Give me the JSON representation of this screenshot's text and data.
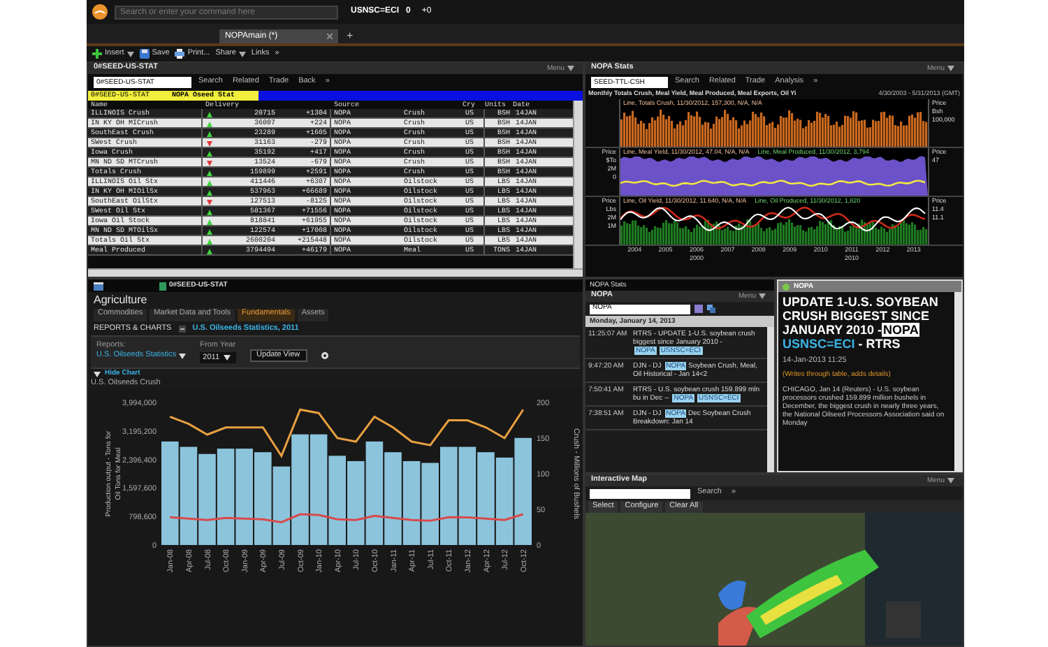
{
  "top_bar": {
    "placeholder": "Search or enter your command here",
    "ticker": "USNSC=ECI",
    "ticker_value": "0",
    "ticker_change": "+0"
  },
  "workspace_tabs": [
    {
      "label": "NOPAmain (*)",
      "selected": true
    }
  ],
  "add_tab": "+",
  "toolbar": [
    {
      "label": "Insert",
      "kind": "add"
    },
    {
      "label": "Save",
      "kind": "save"
    },
    {
      "label": "Print...",
      "kind": "print"
    },
    {
      "label": "Share",
      "kind": "menu"
    },
    {
      "label": "Links",
      "kind": "plain"
    },
    {
      "label": "»",
      "kind": "plain"
    }
  ],
  "quote_list": {
    "title": "0#SEED-US-STAT",
    "menu": "Menu",
    "code": "0#SEED-US-STAT",
    "tools": [
      "Search",
      "Related",
      "Trade",
      "Back",
      "»"
    ],
    "chain": "0#SEED-US-STAT",
    "chain_title": "NOPA Oseed Stat",
    "columns": [
      "Name",
      "Delivery",
      "Source",
      "Cry",
      "Units",
      "Date"
    ],
    "rows": [
      {
        "name": "ILLINOIS Crush",
        "up": true,
        "value": "20715",
        "change": "+1304",
        "source": "NOPA",
        "type": "Crush",
        "country": "US",
        "units": "BSH",
        "date": "14JAN"
      },
      {
        "name": "IN KY OH MICrush",
        "up": true,
        "value": "36007",
        "change": "+224",
        "source": "NOPA",
        "type": "Crush",
        "country": "US",
        "units": "BSH",
        "date": "14JAN"
      },
      {
        "name": "SouthEast Crush",
        "up": true,
        "value": "23289",
        "change": "+1605",
        "source": "NOPA",
        "type": "Crush",
        "country": "US",
        "units": "BSH",
        "date": "14JAN"
      },
      {
        "name": "SWest Crush",
        "up": false,
        "value": "31163",
        "change": "-279",
        "source": "NOPA",
        "type": "Crush",
        "country": "US",
        "units": "BSH",
        "date": "14JAN"
      },
      {
        "name": "Iowa Crush",
        "up": true,
        "value": "35192",
        "change": "+417",
        "source": "NOPA",
        "type": "Crush",
        "country": "US",
        "units": "BSH",
        "date": "14JAN"
      },
      {
        "name": "MN ND SD MTCrush",
        "up": false,
        "value": "13524",
        "change": "-679",
        "source": "NOPA",
        "type": "Crush",
        "country": "US",
        "units": "BSH",
        "date": "14JAN"
      },
      {
        "name": "Totals Crush",
        "up": true,
        "value": "159899",
        "change": "+2591",
        "source": "NOPA",
        "type": "Crush",
        "country": "US",
        "units": "BSH",
        "date": "14JAN"
      },
      {
        "name": "ILLINOIS Oil Stx",
        "up": true,
        "value": "411446",
        "change": "+6307",
        "source": "NOPA",
        "type": "Oilstock",
        "country": "US",
        "units": "LBS",
        "date": "14JAN"
      },
      {
        "name": "IN KY OH MIOilSx",
        "up": true,
        "value": "537963",
        "change": "+66689",
        "source": "NOPA",
        "type": "Oilstock",
        "country": "US",
        "units": "LBS",
        "date": "14JAN"
      },
      {
        "name": "SouthEast OilStx",
        "up": false,
        "value": "127513",
        "change": "-8125",
        "source": "NOPA",
        "type": "Oilstock",
        "country": "US",
        "units": "LBS",
        "date": "14JAN"
      },
      {
        "name": "SWest Oil Stx",
        "up": true,
        "value": "581367",
        "change": "+71556",
        "source": "NOPA",
        "type": "Oilstock",
        "country": "US",
        "units": "LBS",
        "date": "14JAN"
      },
      {
        "name": "Iowa Oil Stock",
        "up": true,
        "value": "818841",
        "change": "+61955",
        "source": "NOPA",
        "type": "Oilstock",
        "country": "US",
        "units": "LBS",
        "date": "14JAN"
      },
      {
        "name": "MN ND SD MTOilSx",
        "up": true,
        "value": "122574",
        "change": "+17008",
        "source": "NOPA",
        "type": "Oilstock",
        "country": "US",
        "units": "LBS",
        "date": "14JAN"
      },
      {
        "name": "Totals Oil Stx",
        "up": true,
        "value": "2600204",
        "change": "+215448",
        "source": "NOPA",
        "type": "Oilstock",
        "country": "US",
        "units": "LBS",
        "date": "14JAN"
      },
      {
        "name": "Meal Produced",
        "up": true,
        "value": "3794494",
        "change": "+46179",
        "source": "NOPA",
        "type": "Meal",
        "country": "US",
        "units": "TONS",
        "date": "14JAN"
      }
    ]
  },
  "stats_panel": {
    "title": "NOPA Stats",
    "menu": "Menu",
    "code": "SEED-TTL-CSH",
    "tools": [
      "Search",
      "Related",
      "Trade",
      "Analysis",
      "»"
    ],
    "chart_title": "Monthly Totals Crush, Meal Yield, Meal Produced, Meal Exports, Oil Yi",
    "date_range": "4/30/2003 - 5/31/2013 (GMT)",
    "panes": [
      {
        "kind": "bars",
        "legends": [
          "Line, Totals Crush, 11/30/2012, 157,300, N/A, N/A"
        ],
        "right_labels": [
          "Price",
          "Bsh",
          "100,000"
        ]
      },
      {
        "kind": "area",
        "legends": [
          "Line, Meal Yield, 11/30/2012, 47.04, N/A, N/A",
          "Line, Meal Produced, 11/30/2012, 3,794"
        ],
        "left_labels": [
          "Price",
          "$To",
          "2M",
          "0"
        ],
        "right_labels": [
          "Price",
          "47"
        ]
      },
      {
        "kind": "lines",
        "legends": [
          "Line, Oil Yield, 11/30/2012, 11.640, N/A, N/A",
          "Line, Oil Produced, 11/30/2012, 1,820"
        ],
        "left_labels": [
          "Price",
          "Lbs",
          "2M",
          "1M"
        ],
        "right_labels": [
          "Price",
          "11.4",
          "11.1"
        ]
      }
    ],
    "years": [
      "2004",
      "2005",
      "2006",
      "2007",
      "2008",
      "2009",
      "2010",
      "2011",
      "2012",
      "2013"
    ],
    "decades": [
      "2000",
      "2010"
    ]
  },
  "agri_panel": {
    "dock_tab": "0#SEED-US-STAT",
    "title": "Agriculture",
    "nav": [
      {
        "label": "Commodities",
        "selected": false
      },
      {
        "label": "Market Data and Tools",
        "selected": false
      },
      {
        "label": "Fundamentals",
        "selected": true
      },
      {
        "label": "Assets",
        "selected": false
      }
    ],
    "section": "REPORTS & CHARTS",
    "report_link": "U.S. Oilseeds Statistics, 2011",
    "reports_label": "Reports:",
    "reports_value": "U.S. Oilseeds Statistics",
    "year_label": "From Year",
    "year_value": "2011",
    "update_button": "Update View",
    "hide_chart": "Hide Chart",
    "chart_data": {
      "type": "bar",
      "title": "U.S. Oilseeds Crush",
      "ylabel": "Production output - Tons for Oil Tons for Meal",
      "y2label": "Crush - Millions of Bushels",
      "categories": [
        "Jan-08",
        "Apr-08",
        "Jul-08",
        "Oct-08",
        "Jan-09",
        "Apr-09",
        "Jul-09",
        "Oct-09",
        "Jan-10",
        "Apr-10",
        "Jul-10",
        "Oct-10",
        "Jan-11",
        "Apr-11",
        "Jul-11",
        "Oct-11",
        "Jan-12",
        "Apr-12",
        "Jul-12",
        "Oct-12"
      ],
      "ylim": [
        0,
        3994000
      ],
      "yticks": [
        {
          "value": 0,
          "label": "0"
        },
        {
          "value": 798600,
          "label": "798,600"
        },
        {
          "value": 1597600,
          "label": "1,597,600"
        },
        {
          "value": 2396400,
          "label": "2,396,400"
        },
        {
          "value": 3195200,
          "label": "3,195,200"
        },
        {
          "value": 3994000,
          "label": "3,994,000"
        }
      ],
      "y2lim": [
        0,
        200
      ],
      "y2ticks": [
        0,
        50,
        100,
        150,
        200
      ],
      "series": [
        {
          "type": "bar",
          "color": "#8cc4dc",
          "values": [
            2900000,
            2750000,
            2550000,
            2700000,
            2700000,
            2600000,
            2200000,
            3100000,
            3100000,
            2500000,
            2350000,
            2900000,
            2600000,
            2350000,
            2300000,
            2750000,
            2750000,
            2600000,
            2450000,
            3000000
          ]
        },
        {
          "type": "line",
          "color": "#d94a4a",
          "values": [
            780000,
            740000,
            700000,
            760000,
            740000,
            720000,
            640000,
            860000,
            840000,
            720000,
            700000,
            820000,
            760000,
            700000,
            680000,
            780000,
            770000,
            740000,
            700000,
            860000
          ]
        },
        {
          "type": "line",
          "axis": "y2",
          "color": "#e8a040",
          "values": [
            180,
            170,
            155,
            165,
            165,
            165,
            125,
            190,
            185,
            150,
            145,
            180,
            165,
            145,
            140,
            175,
            175,
            165,
            150,
            190
          ]
        }
      ]
    }
  },
  "news_panel": {
    "dock_tab": "NOPA Stats",
    "title": "NOPA",
    "menu": "Menu",
    "query": "NOPA",
    "date": "Monday, January 14, 2013",
    "items": [
      {
        "time": "11:25:07 AM",
        "segments": [
          {
            "kind": "plain",
            "text": "RTRS - UPDATE 1-U.S. soybean crush biggest since January 2010 -"
          },
          {
            "kind": "tag",
            "text": "NOPA"
          },
          {
            "kind": "tag",
            "text": "USNSC=ECI"
          }
        ]
      },
      {
        "time": "9:47:20 AM",
        "segments": [
          {
            "kind": "plain",
            "text": "DJN - DJ"
          },
          {
            "kind": "tag",
            "text": "NOPA"
          },
          {
            "kind": "plain",
            "text": "Soybean Crush, Meal, Oil Historical - Jan 14<2"
          }
        ]
      },
      {
        "time": "7:50:41 AM",
        "segments": [
          {
            "kind": "plain",
            "text": "RTRS - U.S. soybean crush 159.899 mln bu in Dec --"
          },
          {
            "kind": "tag",
            "text": "NOPA"
          },
          {
            "kind": "tag",
            "text": "USNSC=ECI"
          }
        ]
      },
      {
        "time": "7:38:51 AM",
        "segments": [
          {
            "kind": "plain",
            "text": "DJN - DJ"
          },
          {
            "kind": "tag",
            "text": "NOPA"
          },
          {
            "kind": "plain",
            "text": "Dec Soybean Crush Breakdown: Jan 14"
          }
        ]
      }
    ]
  },
  "article": {
    "title": "NOPA",
    "headline": "UPDATE 1-U.S. SOYBEAN CRUSH BIGGEST SINCE JANUARY 2010 -",
    "tag": "NOPA",
    "code": "USNSC=ECI",
    "source": "- RTRS",
    "timestamp": "14-Jan-2013 11:25",
    "note": "(Writes through table, adds details)",
    "body": "CHICAGO, Jan 14 (Reuters) - U.S. soybean processors crushed 159.899 million bushels in December, the biggest crush in nearly three years, the National Oilseed Processors Association said on Monday"
  },
  "map_panel": {
    "title": "Interactive Map",
    "menu": "Menu",
    "tools": [
      "Search",
      "»"
    ],
    "controls": [
      "Select",
      "Configure",
      "Clear All"
    ]
  }
}
